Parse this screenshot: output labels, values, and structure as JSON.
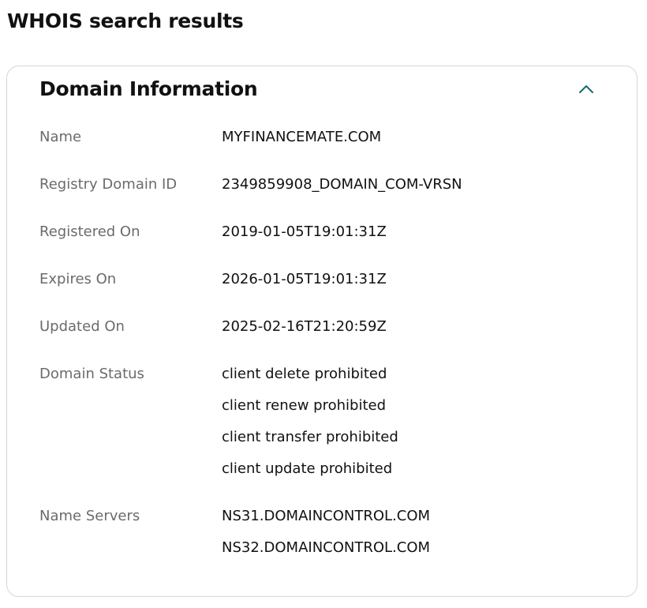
{
  "page": {
    "title": "WHOIS search results"
  },
  "section": {
    "title": "Domain Information",
    "toggle_icon": "chevron-up-icon",
    "accent_color": "#1a6b6b"
  },
  "domain_info": {
    "name": {
      "label": "Name",
      "value": "MYFINANCEMATE.COM"
    },
    "registry_domain_id": {
      "label": "Registry Domain ID",
      "value": "2349859908_DOMAIN_COM-VRSN"
    },
    "registered_on": {
      "label": "Registered On",
      "value": "2019-01-05T19:01:31Z"
    },
    "expires_on": {
      "label": "Expires On",
      "value": "2026-01-05T19:01:31Z"
    },
    "updated_on": {
      "label": "Updated On",
      "value": "2025-02-16T21:20:59Z"
    },
    "domain_status": {
      "label": "Domain Status",
      "values": [
        "client delete prohibited",
        "client renew prohibited",
        "client transfer prohibited",
        "client update prohibited"
      ]
    },
    "name_servers": {
      "label": "Name Servers",
      "values": [
        "NS31.DOMAINCONTROL.COM",
        "NS32.DOMAINCONTROL.COM"
      ]
    }
  }
}
